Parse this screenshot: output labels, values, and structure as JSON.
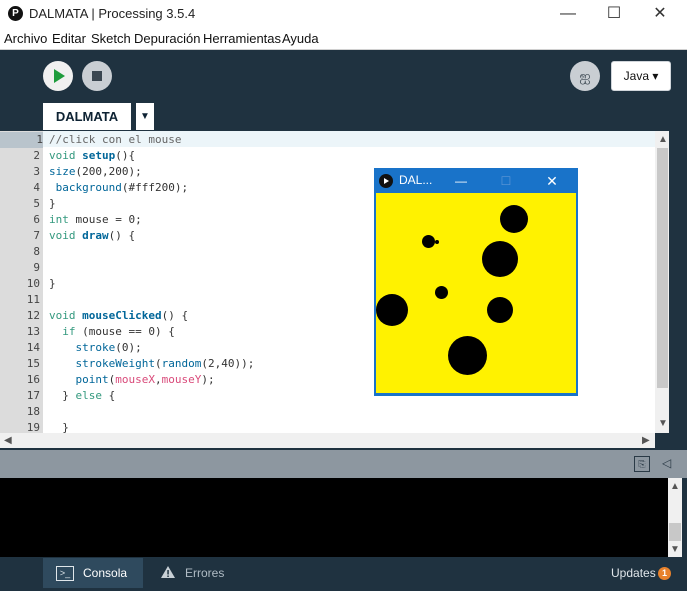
{
  "window": {
    "title": "DALMATA | Processing 3.5.4",
    "controls": {
      "minimize": "—",
      "maximize": "☐",
      "close": "✕"
    }
  },
  "menubar": [
    "Archivo",
    "Editar",
    "Sketch",
    "Depuración",
    "Herramientas",
    "Ayuda"
  ],
  "toolbar": {
    "mode_label": "Java ▾"
  },
  "tab": {
    "name": "DALMATA",
    "menu_glyph": "▼"
  },
  "code": {
    "line_numbers": [
      "1",
      "2",
      "3",
      "4",
      "5",
      "6",
      "7",
      "8",
      "9",
      "10",
      "11",
      "12",
      "13",
      "14",
      "15",
      "16",
      "17",
      "18",
      "19"
    ]
  },
  "sketch_window": {
    "title": "DAL...",
    "canvas_color": "#fff200"
  },
  "footer": {
    "console_label": "Consola",
    "errors_label": "Errores",
    "updates_label": "Updates",
    "updates_count": "1"
  },
  "colors": {
    "toolbar_bg": "#1f3240",
    "accent_run": "#1e9c3c",
    "updates_badge": "#e8822c"
  }
}
